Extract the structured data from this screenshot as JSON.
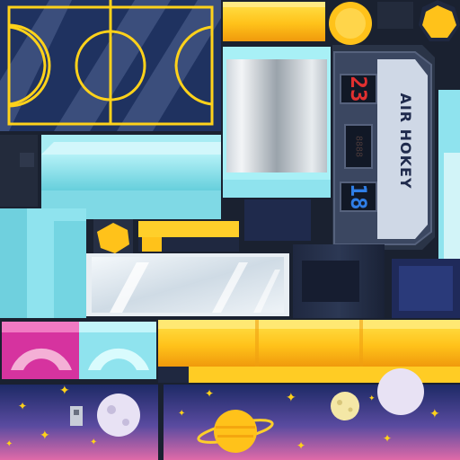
{
  "atlas": {
    "kind": "air hockey game texture atlas",
    "colors": {
      "background": "#1a2130",
      "rink_navy": "#1f3260",
      "rink_line": "#ffd21a",
      "glass": "#dbe6ef",
      "cyan": "#8fe3ee",
      "yellow": "#ffc21a",
      "magenta": "#d6339f",
      "scoreboard": "#2a3447",
      "score_red": "#e03030",
      "score_blue": "#2f7ee6",
      "space_top": "#1d2a66",
      "space_bottom": "#e06aa8"
    }
  },
  "scoreboard": {
    "logo_text": "AIR HOKEY",
    "home_score": "23",
    "away_score": "18",
    "timer": "8888"
  },
  "icons": {
    "puck": "puck-icon",
    "hex_bolt": "hex-bolt-icon",
    "star": "star-icon",
    "planet": "planet-icon",
    "moon": "moon-icon"
  }
}
